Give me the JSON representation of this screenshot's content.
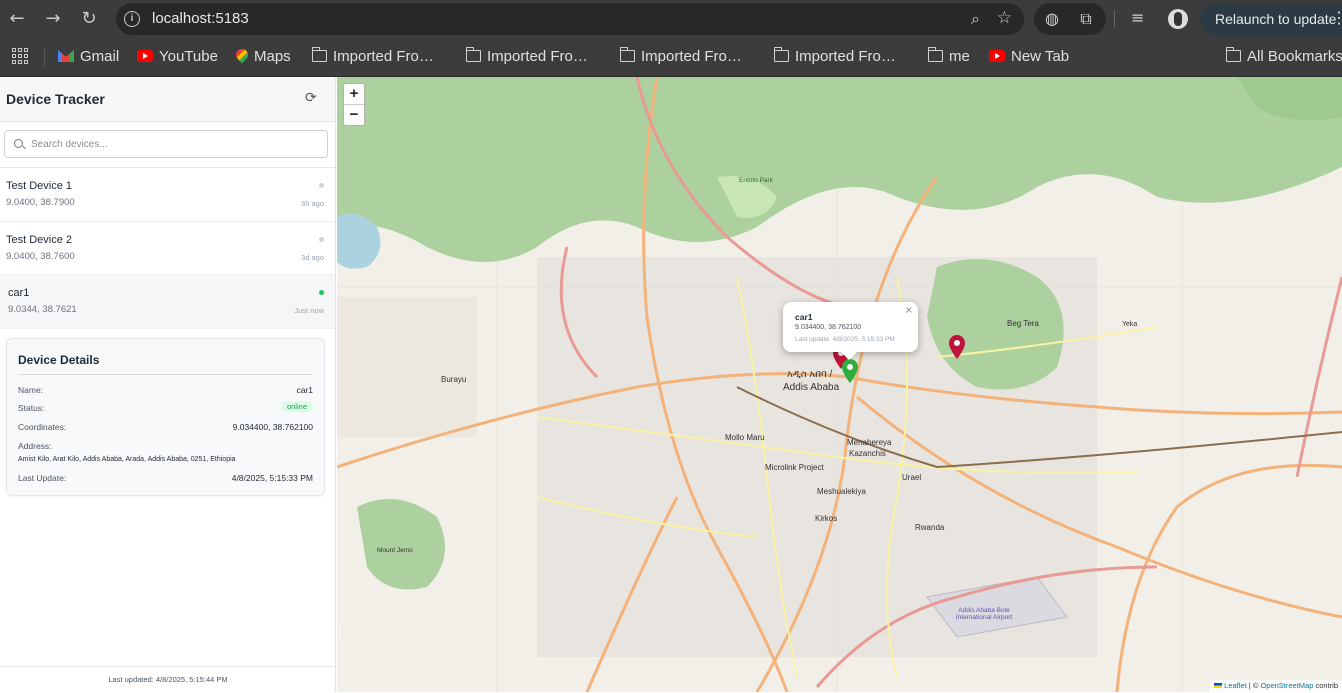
{
  "browser": {
    "url": "localhost:5183",
    "relaunch_label": "Relaunch to update",
    "bookmarks": [
      {
        "label": "Gmail",
        "icon": "gmail-icon"
      },
      {
        "label": "YouTube",
        "icon": "youtube-icon"
      },
      {
        "label": "Maps",
        "icon": "maps-icon"
      },
      {
        "label": "Imported Fro…",
        "icon": "folder-icon"
      },
      {
        "label": "Imported Fro…",
        "icon": "folder-icon"
      },
      {
        "label": "Imported Fro…",
        "icon": "folder-icon"
      },
      {
        "label": "Imported Fro…",
        "icon": "folder-icon"
      },
      {
        "label": "me",
        "icon": "folder-icon"
      },
      {
        "label": "New Tab",
        "icon": "youtube-icon"
      }
    ],
    "all_bookmarks": "All Bookmarks"
  },
  "sidebar": {
    "title": "Device Tracker",
    "search_placeholder": "Search devices...",
    "devices": [
      {
        "name": "Test Device 1",
        "coords": "9.0400, 38.7900",
        "time": "3h ago",
        "status": "offline"
      },
      {
        "name": "Test Device 2",
        "coords": "9.0400, 38.7600",
        "time": "3d ago",
        "status": "offline"
      },
      {
        "name": "car1",
        "coords": "9.0344, 38.7621",
        "time": "Just now",
        "status": "online"
      }
    ],
    "details": {
      "title": "Device Details",
      "name_label": "Name:",
      "name_value": "car1",
      "status_label": "Status:",
      "status_value": "online",
      "coords_label": "Coordinates:",
      "coords_value": "9.034400, 38.762100",
      "address_label": "Address:",
      "address_value": "Amist Kilo, Arat Kilo, Addis Ababa, Arada, Addis Ababa, 0251, Ethiopia",
      "update_label": "Last Update:",
      "update_value": "4/8/2025, 5:15:33 PM"
    },
    "footer": "Last updated: 4/8/2025, 5:15:44 PM"
  },
  "map": {
    "zoom_in": "+",
    "zoom_out": "−",
    "popup": {
      "name": "car1",
      "coords": "9.034400, 38.762100",
      "update": "Last update: 4/8/2025, 5:15:33 PM",
      "close": "×"
    },
    "labels": [
      {
        "text": "አዲስ አበባ /"
      },
      {
        "text": "Addis Ababa"
      },
      {
        "text": "Burayu"
      },
      {
        "text": "Beg Tera"
      },
      {
        "text": "Menahereya"
      },
      {
        "text": "Kazanchis"
      },
      {
        "text": "Microlink Project"
      },
      {
        "text": "Mollo Maru"
      },
      {
        "text": "Meshualekiya"
      },
      {
        "text": "Kirkos"
      },
      {
        "text": "Rwanda"
      },
      {
        "text": "Urael"
      },
      {
        "text": "Addis Ababa Bole International Airport"
      },
      {
        "text": "Entoto Park"
      },
      {
        "text": "Mount Jemo"
      },
      {
        "text": "Yeka"
      }
    ],
    "attribution_leaflet": "Leaflet",
    "attribution_sep": " | © ",
    "attribution_osm": "OpenStreetMap",
    "attribution_rest": " contrib"
  },
  "colors": {
    "online": "#22c55e",
    "offline": "#d1d5db",
    "marker_red": "#c0143c",
    "marker_green": "#2eae3e",
    "forest": "#add19e",
    "primary_road": "#f4b27b",
    "secondary_road": "#f7f3a5"
  }
}
